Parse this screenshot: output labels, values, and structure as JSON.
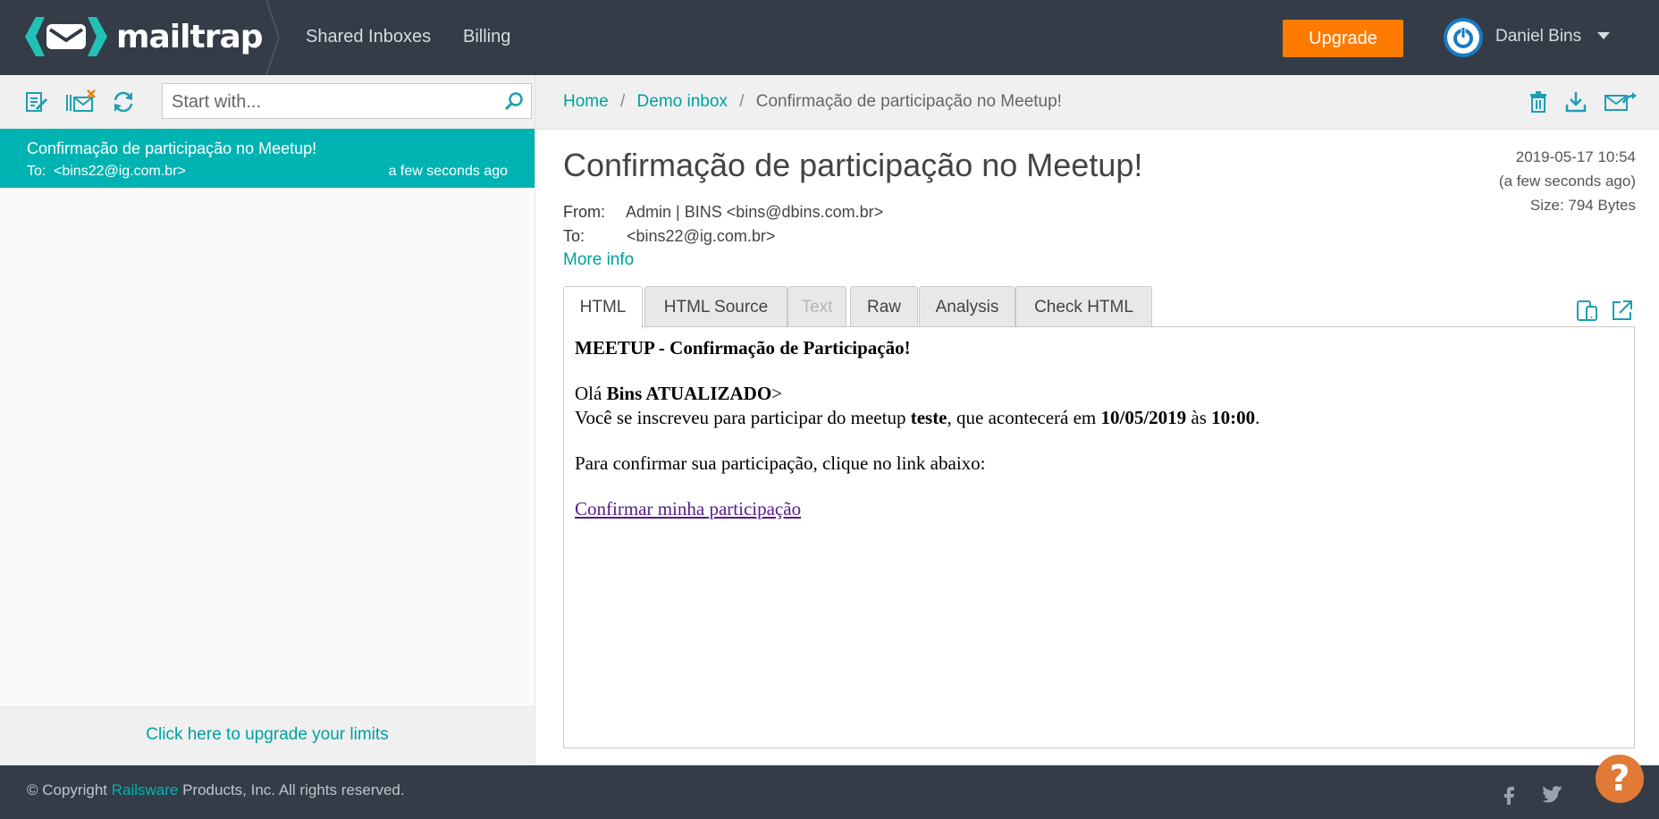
{
  "app": {
    "name": "mailtrap"
  },
  "nav": {
    "shared_inboxes": "Shared Inboxes",
    "billing": "Billing",
    "upgrade": "Upgrade"
  },
  "user": {
    "name": "Daniel Bins"
  },
  "search": {
    "placeholder": "Start with..."
  },
  "messages": [
    {
      "subject": "Confirmação de participação no Meetup!",
      "to_label": "To:",
      "to": "<bins22@ig.com.br>",
      "time": "a few seconds ago"
    }
  ],
  "upgrade_limits": "Click here to upgrade your limits",
  "breadcrumb": {
    "home": "Home",
    "sep": "/",
    "inbox": "Demo inbox",
    "current": "Confirmação de participação no Meetup!"
  },
  "email": {
    "subject": "Confirmação de participação no Meetup!",
    "date": "2019-05-17 10:54",
    "relative": "(a few seconds ago)",
    "size": "Size: 794 Bytes",
    "from_label": "From:",
    "from": "Admin | BINS <bins@dbins.com.br>",
    "to_label": "To:",
    "to": "<bins22@ig.com.br>",
    "more_info": "More info"
  },
  "tabs": [
    {
      "label": "HTML"
    },
    {
      "label": "HTML Source"
    },
    {
      "label": "Text"
    },
    {
      "label": "Raw"
    },
    {
      "label": "Analysis"
    },
    {
      "label": "Check HTML"
    }
  ],
  "preview": {
    "title": "MEETUP - Confirmação de Participação!",
    "greeting_prefix": "Olá ",
    "greeting_name": "Bins ATUALIZADO",
    "greeting_suffix": ">",
    "line2_a": "Você se inscreveu para participar do meetup ",
    "line2_meetup": "teste",
    "line2_b": ", que acontecerá em ",
    "line2_date": "10/05/2019",
    "line2_c": " às ",
    "line2_time": "10:00",
    "line2_d": ".",
    "confirm_text": "Para confirmar sua participação, clique no link abaixo:",
    "confirm_link": "Confirmar minha participação"
  },
  "footer": {
    "copyright_prefix": "© Copyright ",
    "brand": "Railsware",
    "copyright_suffix": " Products, Inc. All rights reserved."
  },
  "help": {
    "label": "?"
  },
  "colors": {
    "navbar": "#333c47",
    "accent": "#00b3b3",
    "link": "#00a0a0",
    "upgrade": "#ff7b00",
    "help": "#e07a36"
  },
  "icons": {
    "toolbar": [
      "compose-icon",
      "clear-inbox-icon",
      "refresh-icon",
      "search-icon"
    ],
    "message_actions": [
      "delete-icon",
      "download-icon",
      "forward-icon"
    ],
    "preview_actions": [
      "mobile-view-icon",
      "open-new-window-icon"
    ],
    "social": [
      "facebook-icon",
      "twitter-icon"
    ]
  }
}
